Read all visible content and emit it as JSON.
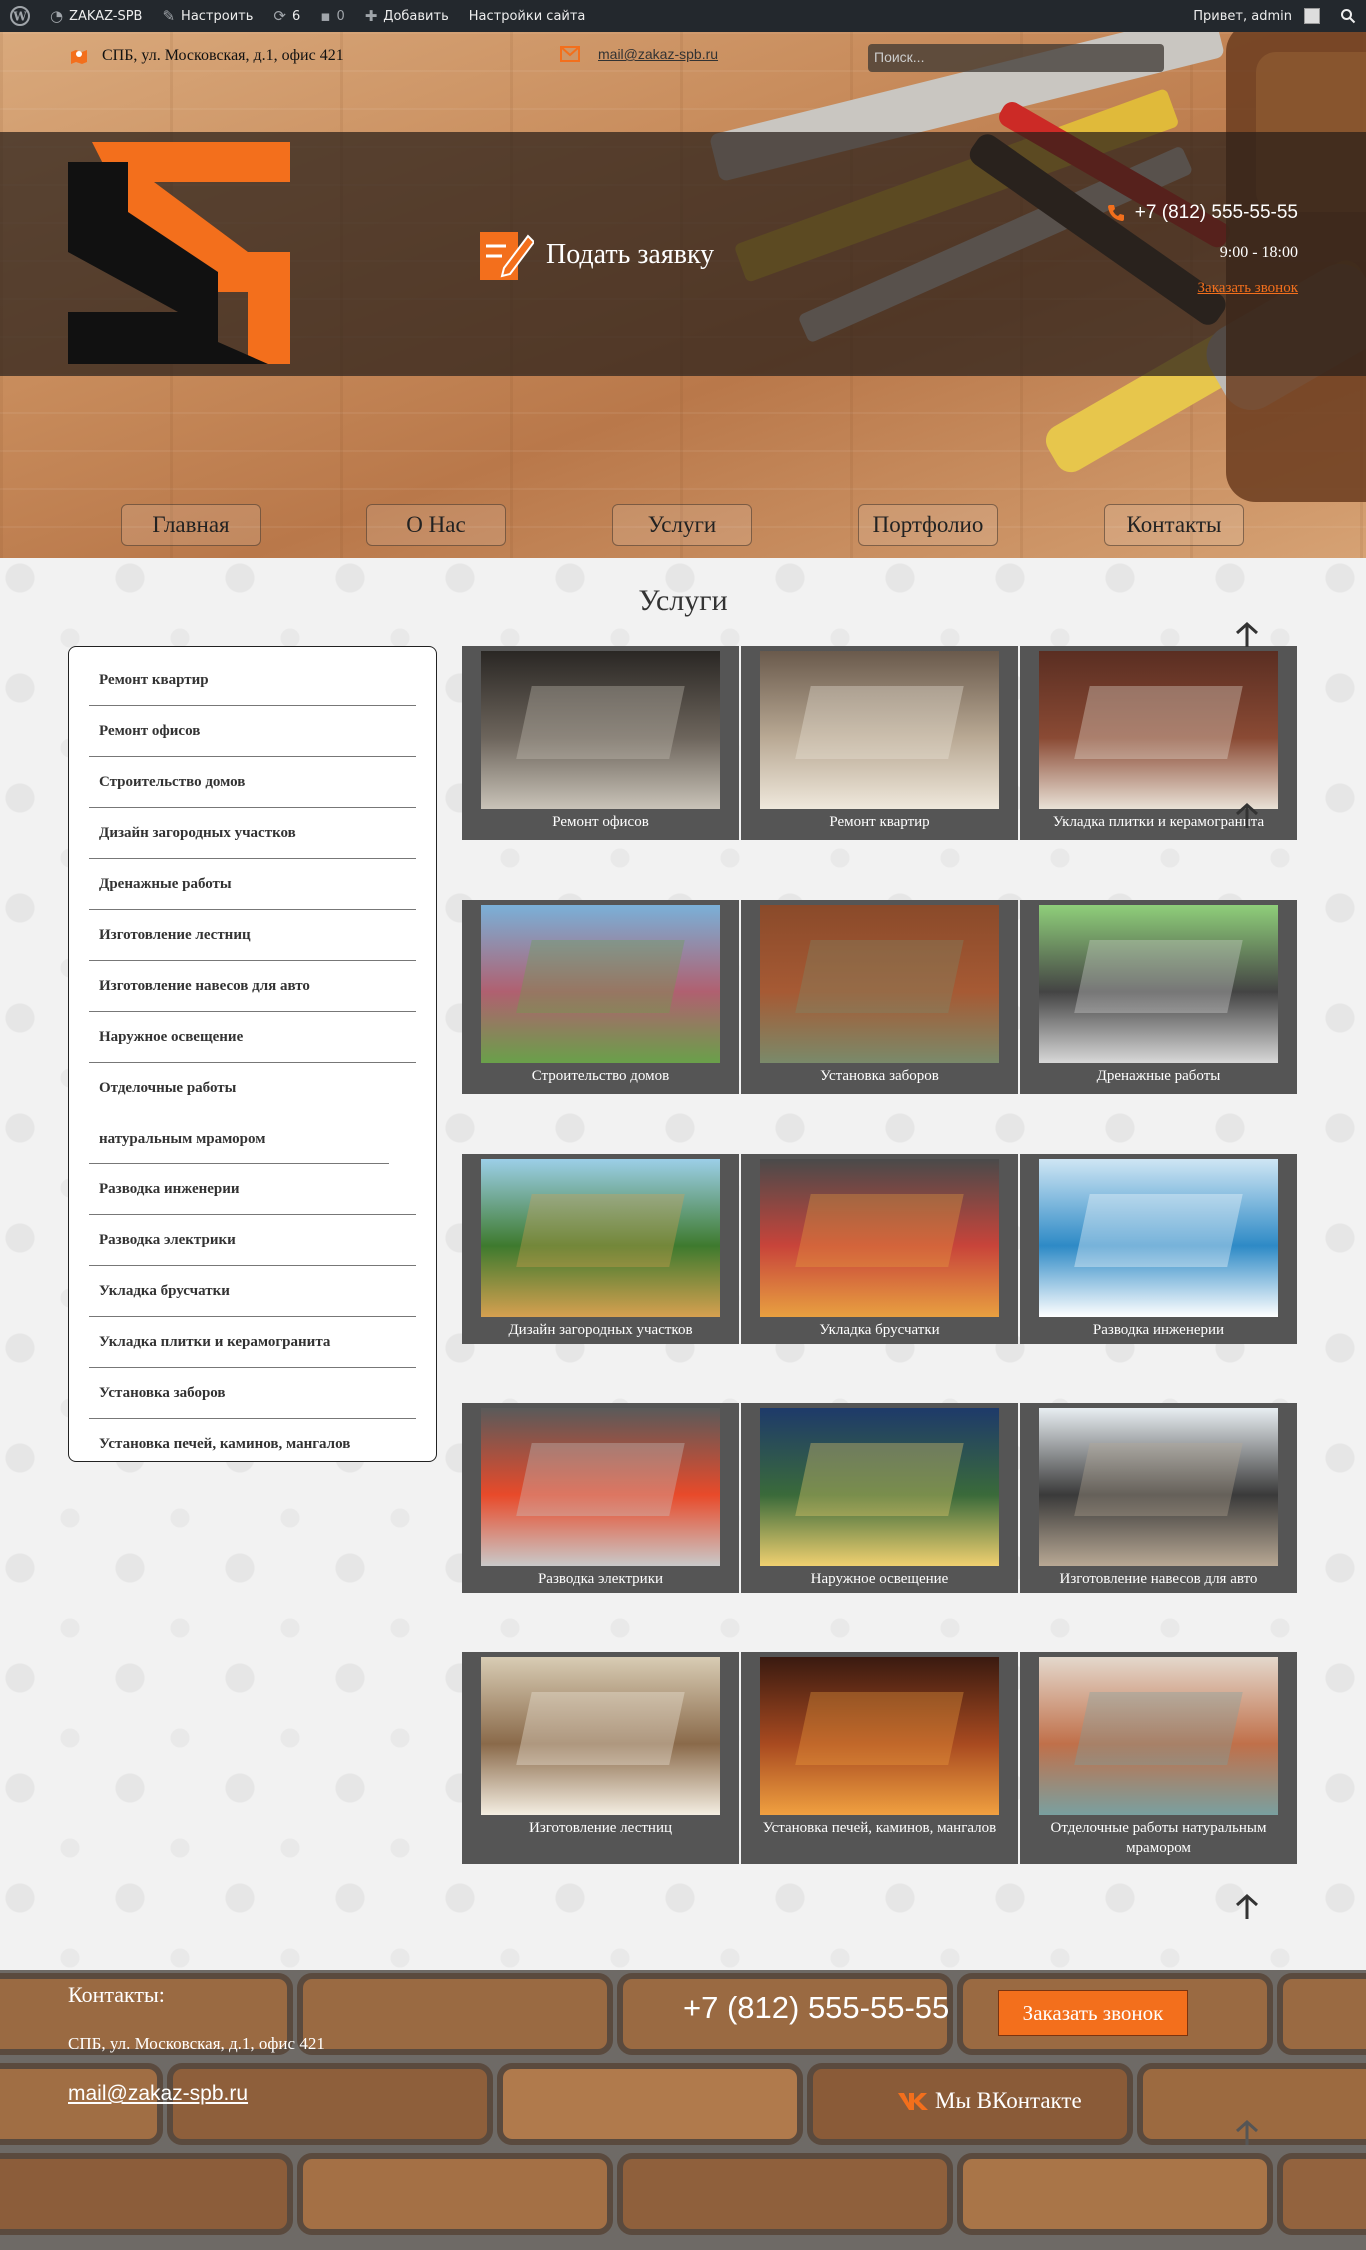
{
  "admin_bar": {
    "site_name": "ZAKAZ-SPB",
    "customize": "Настроить",
    "updates_count": "6",
    "comments_count": "0",
    "add_new": "Добавить",
    "site_settings": "Настройки сайта",
    "greeting": "Привет, admin"
  },
  "header": {
    "address": "СПБ, ул. Московская, д.1, офис 421",
    "email": "mail@zakaz-spb.ru",
    "search_placeholder": "Поиск...",
    "apply_label": "Подать заявку",
    "phone": "+7 (812) 555-55-55",
    "hours": "9:00 - 18:00",
    "callback_link": "Заказать звонок",
    "accent_color": "#f36f1c"
  },
  "nav": [
    "Главная",
    "О Нас",
    "Услуги",
    "Портфолио",
    "Контакты"
  ],
  "page_title": "Услуги",
  "sidebar": [
    "Ремонт квартир",
    "Ремонт офисов",
    "Строительство домов",
    "Дизайн загородных участков",
    "Дренажные работы",
    "Изготовление лестниц",
    "Изготовление навесов для авто",
    "Наружное освещение",
    "Отделочные работы натуральным мрамором",
    "Разводка инженерии",
    "Разводка электрики",
    "Укладка брусчатки",
    "Укладка плитки и керамогранита",
    "Установка заборов",
    "Установка печей, каминов, мангалов"
  ],
  "services": [
    {
      "title": "Ремонт офисов",
      "image": "office-interior"
    },
    {
      "title": "Ремонт квартир",
      "image": "bedroom-interior"
    },
    {
      "title": "Укладка плитки и керамогранита",
      "image": "tile-floor"
    },
    {
      "title": "Строительство домов",
      "image": "house-construction"
    },
    {
      "title": "Установка заборов",
      "image": "brick-fence"
    },
    {
      "title": "Дренажные работы",
      "image": "drainage-system"
    },
    {
      "title": "Дизайн загородных участков",
      "image": "garden-design"
    },
    {
      "title": "Укладка брусчатки",
      "image": "paving-stones"
    },
    {
      "title": "Разводка инженерии",
      "image": "engineering-blueprint"
    },
    {
      "title": "Разводка электрики",
      "image": "electrical-wiring"
    },
    {
      "title": "Наружное освещение",
      "image": "outdoor-lighting"
    },
    {
      "title": "Изготовление навесов для авто",
      "image": "car-canopy"
    },
    {
      "title": "Изготовление лестниц",
      "image": "staircase"
    },
    {
      "title": "Установка печей, каминов, мангалов",
      "image": "fireplace"
    },
    {
      "title": "Отделочные работы натуральным мрамором",
      "image": "marble-bathroom"
    }
  ],
  "footer": {
    "title": "Контакты:",
    "address": "СПБ, ул. Московская, д.1, офис 421",
    "email": "mail@zakaz-spb.ru",
    "phone": "+7 (812) 555-55-55",
    "callback_button": "Заказать звонок",
    "vk_label": "Мы ВКонтакте"
  }
}
